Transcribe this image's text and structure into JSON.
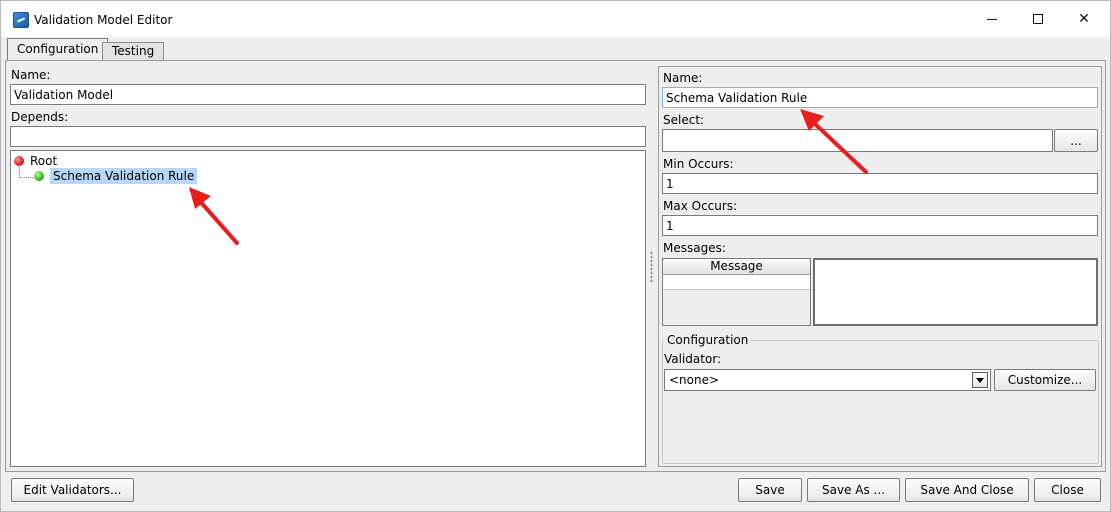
{
  "window": {
    "title": "Validation Model Editor"
  },
  "tabs": [
    {
      "label": "Configuration"
    },
    {
      "label": "Testing"
    }
  ],
  "left": {
    "name_label": "Name:",
    "name_value": "Validation Model",
    "depends_label": "Depends:",
    "depends_value": "",
    "tree": {
      "root": "Root",
      "child": "Schema Validation Rule"
    }
  },
  "right": {
    "name_label": "Name:",
    "name_value": "Schema Validation Rule",
    "select_label": "Select:",
    "select_value": "",
    "browse_label": "...",
    "min_label": "Min Occurs:",
    "min_value": "1",
    "max_label": "Max Occurs:",
    "max_value": "1",
    "messages_label": "Messages:",
    "messages_column": "Message",
    "configuration_title": "Configuration",
    "validator_label": "Validator:",
    "validator_value": "<none>",
    "customize_label": "Customize..."
  },
  "footer": {
    "edit_validators": "Edit Validators...",
    "save": "Save",
    "save_as": "Save As ...",
    "save_and_close": "Save And Close",
    "close": "Close"
  },
  "colors": {
    "annotation_arrow": "#e81e1e",
    "selection": "#b8d6f5"
  }
}
